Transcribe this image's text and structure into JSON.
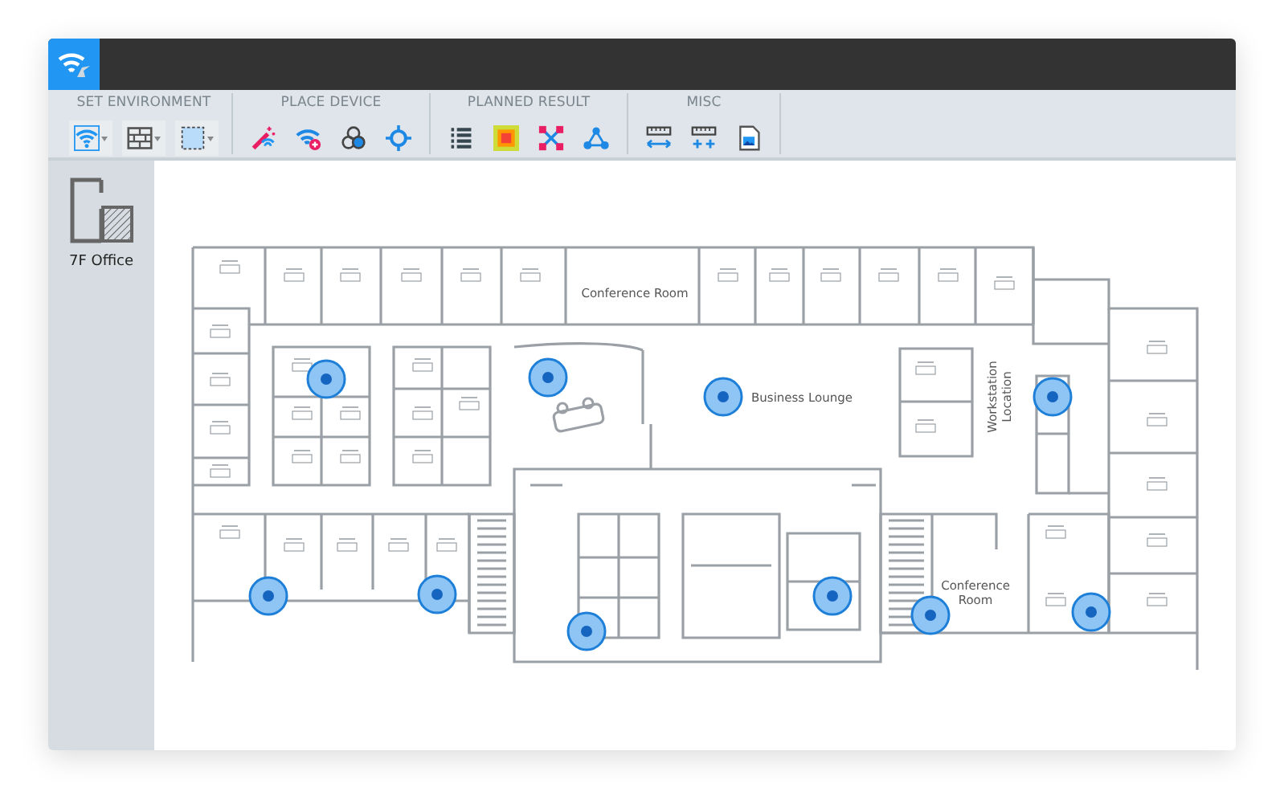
{
  "toolbar": {
    "groups": [
      {
        "label": "SET ENVIRONMENT",
        "tools": [
          {
            "dropdown": true
          },
          {
            "dropdown": true
          },
          {
            "dropdown": true
          }
        ]
      },
      {
        "label": "PLACE DEVICE",
        "tools": [
          {
            "dropdown": false
          },
          {
            "dropdown": false
          },
          {
            "dropdown": false
          },
          {
            "dropdown": false
          }
        ]
      },
      {
        "label": "PLANNED RESULT",
        "tools": [
          {
            "dropdown": false
          },
          {
            "dropdown": false
          },
          {
            "dropdown": false
          },
          {
            "dropdown": false
          }
        ]
      },
      {
        "label": "MISC",
        "tools": [
          {
            "dropdown": false
          },
          {
            "dropdown": false
          },
          {
            "dropdown": false
          }
        ]
      }
    ]
  },
  "sidebar": {
    "floors": [
      {
        "label": "7F Office"
      }
    ]
  },
  "floor_plan": {
    "labels": [
      "Conference Room",
      "Business Lounge",
      "Workstation Location",
      "Conference Room"
    ]
  }
}
